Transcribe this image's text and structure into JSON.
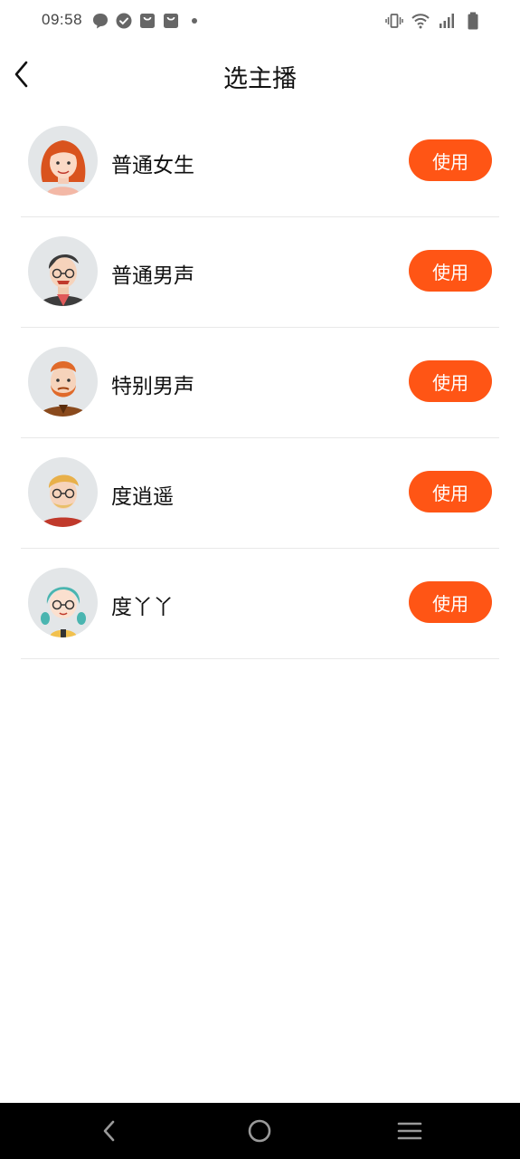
{
  "status_bar": {
    "time": "09:58",
    "left_icons": [
      "chat-bubble-icon",
      "check-badge-icon",
      "shopping-bag-icon",
      "shopping-bag-icon",
      "dot-icon"
    ],
    "right_icons": [
      "vibrate-icon",
      "wifi-icon",
      "signal-icon",
      "battery-icon"
    ]
  },
  "header": {
    "title": "选主播",
    "back_icon": "chevron-left-icon"
  },
  "voices": [
    {
      "name": "普通女生",
      "button": "使用",
      "avatar": "female-redhead-avatar"
    },
    {
      "name": "普通男声",
      "button": "使用",
      "avatar": "male-glasses-avatar"
    },
    {
      "name": "特别男声",
      "button": "使用",
      "avatar": "male-beard-avatar"
    },
    {
      "name": "度逍遥",
      "button": "使用",
      "avatar": "male-blond-glasses-avatar"
    },
    {
      "name": "度丫丫",
      "button": "使用",
      "avatar": "girl-teal-hair-avatar"
    }
  ],
  "colors": {
    "accent": "#ff5515",
    "avatar_bg": "#e3e6e8",
    "divider": "#e8e8e8",
    "nav_bar": "#000000"
  },
  "nav_bar": {
    "icons": [
      "back-triangle-icon",
      "home-circle-icon",
      "menu-lines-icon"
    ]
  }
}
